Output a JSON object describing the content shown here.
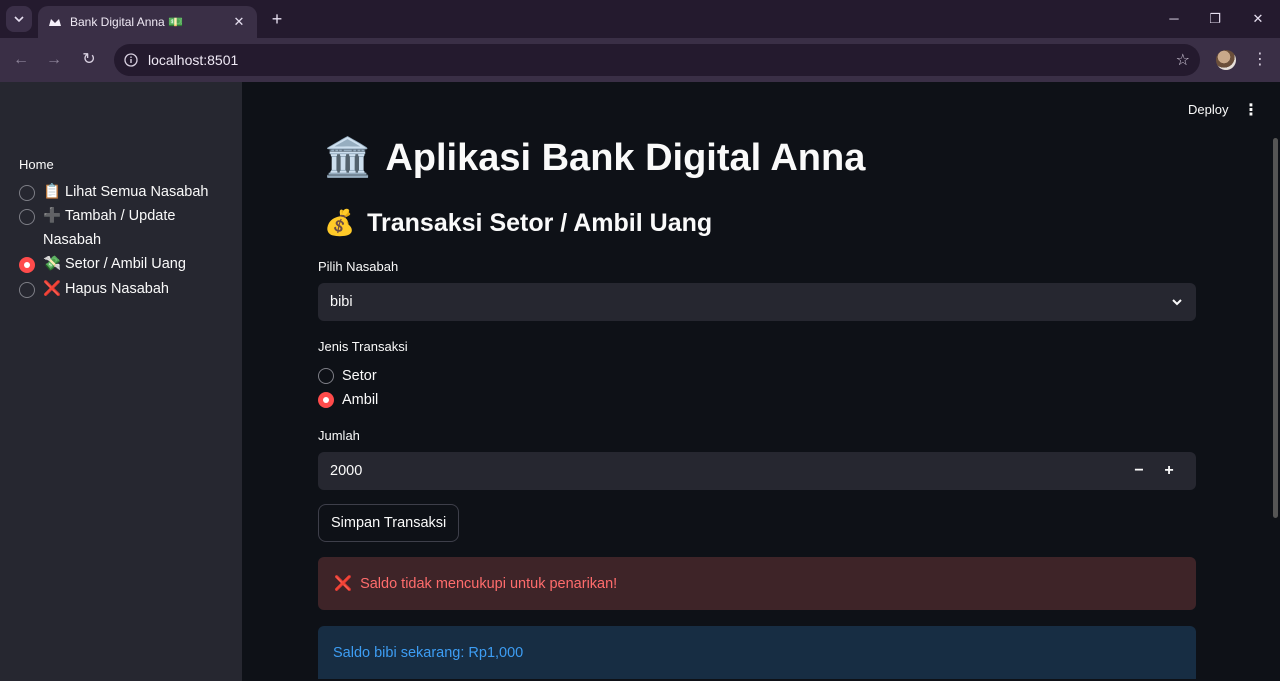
{
  "browser": {
    "tab_title": "Bank Digital Anna",
    "url": "localhost:8501"
  },
  "sidebar": {
    "label": "Home",
    "items": [
      {
        "icon": "📋",
        "label": "Lihat Semua Nasabah",
        "selected": false
      },
      {
        "icon": "➕",
        "label": "Tambah / Update Nasabah",
        "selected": false
      },
      {
        "icon": "💸",
        "label": "Setor / Ambil Uang",
        "selected": true
      },
      {
        "icon": "❌",
        "label": "Hapus Nasabah",
        "selected": false
      }
    ]
  },
  "header": {
    "deploy_label": "Deploy"
  },
  "main": {
    "title_icon": "🏛️",
    "title": "Aplikasi Bank Digital Anna",
    "subtitle_icon": "💰",
    "subtitle": "Transaksi Setor / Ambil Uang",
    "nasabah_label": "Pilih Nasabah",
    "nasabah_value": "bibi",
    "jenis_label": "Jenis Transaksi",
    "jenis_options": [
      {
        "label": "Setor",
        "selected": false
      },
      {
        "label": "Ambil",
        "selected": true
      }
    ],
    "jumlah_label": "Jumlah",
    "jumlah_value": "2000",
    "submit_label": "Simpan Transaksi",
    "error_icon": "❌",
    "error_text": "Saldo tidak mencukupi untuk penarikan!",
    "info_text": "Saldo bibi sekarang: Rp1,000"
  },
  "colors": {
    "accent": "#ff4b4b",
    "background": "#0e1117",
    "sidebar": "#262730",
    "error_bg": "#3e2428",
    "info_bg": "#172d43"
  }
}
